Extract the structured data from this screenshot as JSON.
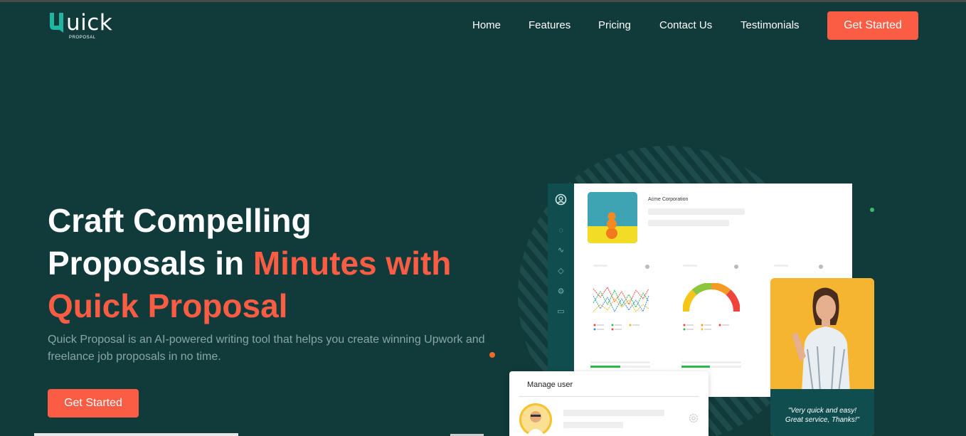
{
  "brand": {
    "logo_text": "uick",
    "logo_sub": "PROPOSAL"
  },
  "nav": {
    "items": [
      {
        "label": "Home"
      },
      {
        "label": "Features"
      },
      {
        "label": "Pricing"
      },
      {
        "label": "Contact Us"
      },
      {
        "label": "Testimonials"
      }
    ],
    "cta": "Get Started"
  },
  "hero": {
    "title_line1": "Craft Compelling",
    "title_line2_a": "Proposals in ",
    "title_line2_b": "Minutes with",
    "title_line3": "Quick Proposal",
    "description": "Quick Proposal is an AI-powered writing tool that helps you create winning Upwork and freelance job proposals in no time.",
    "cta": "Get Started"
  },
  "dashboard": {
    "company": "Acme Corporation",
    "manage_title": "Manage user"
  },
  "testimonial": {
    "quote_line1": "\"Very quick and easy!",
    "quote_line2": "Great service, Thanks!\""
  },
  "colors": {
    "background": "#113a3b",
    "accent": "#fa5d44",
    "sidebar": "#0f4d4e",
    "testimonial_bg": "#f6b530"
  }
}
